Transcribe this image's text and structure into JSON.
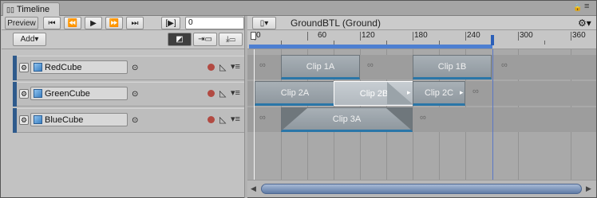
{
  "window": {
    "tab_title": "Timeline",
    "lock_icon": "lock-icon",
    "menu_icon": "hamburger-icon"
  },
  "toolbar": {
    "preview_label": "Preview",
    "goto_start_icon": "skip-to-start-icon",
    "prev_frame_icon": "previous-frame-icon",
    "play_icon": "play-icon",
    "next_frame_icon": "next-frame-icon",
    "goto_end_icon": "skip-to-end-icon",
    "play_range_label": "[▶]",
    "frame_value": "0"
  },
  "add_menu": {
    "label": "Add▾"
  },
  "edit_modes": {
    "mix_icon": "mix-mode-icon",
    "ripple_icon": "ripple-mode-icon",
    "replace_icon": "replace-mode-icon"
  },
  "sequence": {
    "title": "GroundBTL (Ground)",
    "gear_icon": "gear-icon"
  },
  "ruler": {
    "ticks": [
      "0",
      "60",
      "120",
      "180",
      "240",
      "300",
      "360"
    ]
  },
  "tracks": [
    {
      "name": "RedCube"
    },
    {
      "name": "GreenCube"
    },
    {
      "name": "BlueCube"
    }
  ],
  "clips": {
    "red_1": "Clip 1A",
    "red_2": "Clip 1B",
    "green_1": "Clip 2A",
    "green_2": "Clip 2B",
    "green_3": "Clip 2C",
    "blue_1": "Clip 3A",
    "gap_icon": "∞"
  },
  "colors": {
    "track_accent": "#2e5a8c",
    "clip_underline": "#2a76a8",
    "range_bar": "#4d7fd1",
    "record": "#b24a42"
  }
}
